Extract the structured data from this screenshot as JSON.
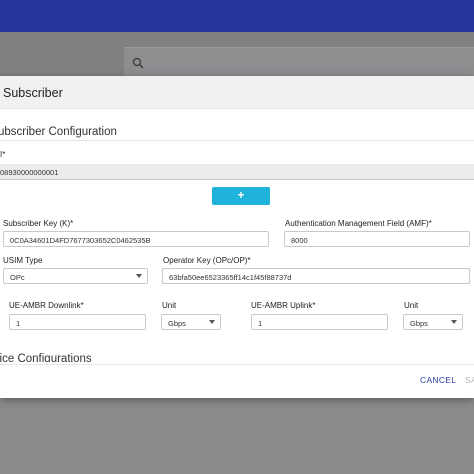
{
  "dialog": {
    "title": "Subscriber",
    "section_title": "ubscriber Configuration",
    "imsi": {
      "label": "I*",
      "value": "08930000000001"
    },
    "add_button_label": "+",
    "subscriber_key": {
      "label": "Subscriber Key (K)*",
      "value": "0C0A34601D4FD7677303652C0462535B"
    },
    "amf": {
      "label": "Authentication Management Field (AMF)*",
      "value": "8000"
    },
    "usim_type": {
      "label": "USIM Type",
      "value": "OPc"
    },
    "operator_key": {
      "label": "Operator Key (OPc/OP)*",
      "value": "63bfa50ee6523365ff14c1f45f88737d"
    },
    "ue_ambr_downlink": {
      "label": "UE-AMBR Downlink*",
      "value": "1"
    },
    "downlink_unit": {
      "label": "Unit",
      "value": "Gbps"
    },
    "ue_ambr_uplink": {
      "label": "UE-AMBR Uplink*",
      "value": "1"
    },
    "uplink_unit": {
      "label": "Unit",
      "value": "Gbps"
    },
    "slice_section_title": "lice Configurations",
    "cancel_label": "CANCEL",
    "save_label": "SA"
  },
  "colors": {
    "top_bar": "#26349a",
    "accent_button": "#1fb3db",
    "cancel_text": "#2f42a6"
  },
  "icons": {
    "search": "search-icon",
    "caret": "chevron-down-icon"
  }
}
